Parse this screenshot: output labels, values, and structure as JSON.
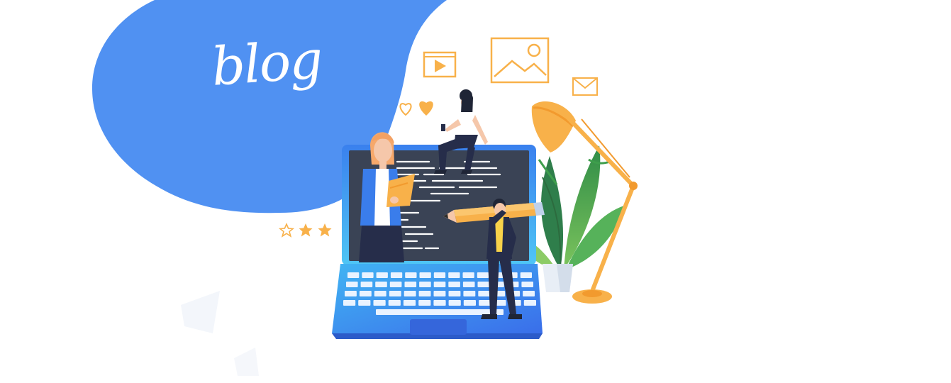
{
  "banner": {
    "title": "blog"
  },
  "colors": {
    "blob": "#5091F2",
    "laptop_frame": "#3E8BEF",
    "screen": "#3A4355",
    "accent_orange": "#F8B14A",
    "leaf_green": "#3E9E4C",
    "suit_navy": "#262D4A"
  },
  "icons": [
    "video-play-icon",
    "image-icon",
    "mail-icon",
    "heart-icon",
    "star-icon",
    "desk-lamp-icon",
    "plant-icon",
    "pencil-icon"
  ]
}
